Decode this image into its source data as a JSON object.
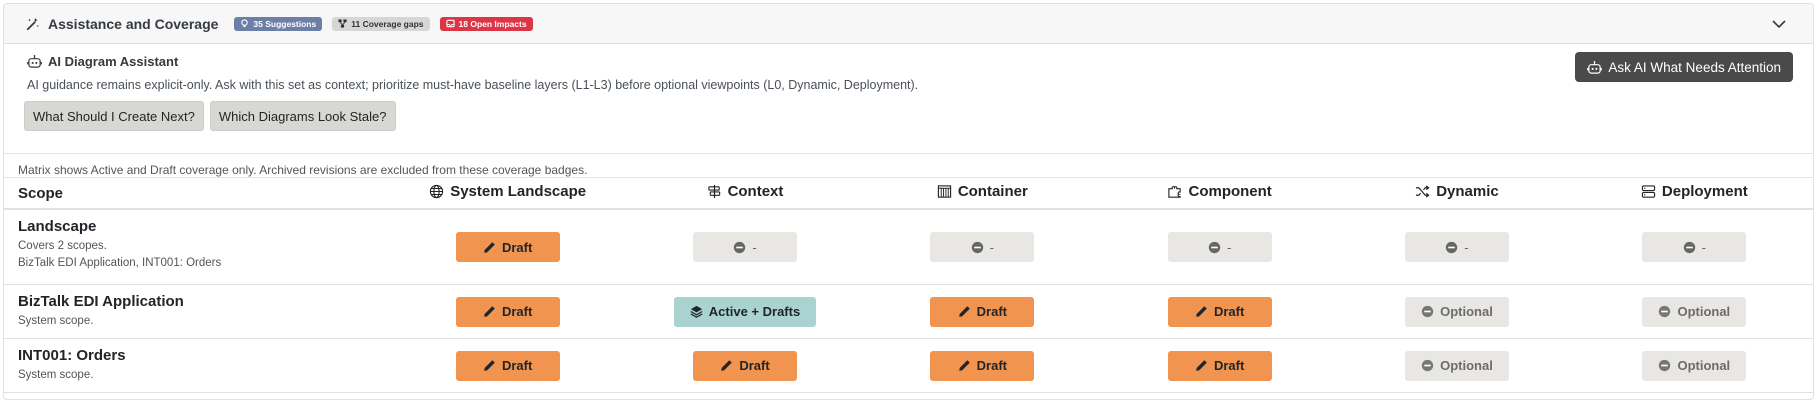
{
  "header": {
    "title": "Assistance and Coverage",
    "badges": {
      "suggestions": "35 Suggestions",
      "gaps": "11 Coverage gaps",
      "impacts": "18 Open Impacts"
    }
  },
  "assistant": {
    "title": "AI Diagram Assistant",
    "description": "AI guidance remains explicit-only. Ask with this set as context; prioritize must-have baseline layers (L1-L3) before optional viewpoints (L0, Dynamic, Deployment).",
    "buttons": {
      "next": "What Should I Create Next?",
      "stale": "Which Diagrams Look Stale?"
    },
    "ask_button": "Ask AI What Needs Attention"
  },
  "note": "Matrix shows Active and Draft coverage only. Archived revisions are excluded from these coverage badges.",
  "columns": {
    "scope": "Scope",
    "landscape": "System Landscape",
    "context": "Context",
    "container": "Container",
    "component": "Component",
    "dynamic": "Dynamic",
    "deployment": "Deployment"
  },
  "rows": [
    {
      "name": "Landscape",
      "meta": "Covers 2 scopes.",
      "meta2": "BizTalk EDI Application, INT001: Orders",
      "cells": [
        "Draft",
        "-",
        "-",
        "-",
        "-",
        "-"
      ]
    },
    {
      "name": "BizTalk EDI Application",
      "meta": "System scope.",
      "cells": [
        "Draft",
        "Active + Drafts",
        "Draft",
        "Draft",
        "Optional",
        "Optional"
      ]
    },
    {
      "name": "INT001: Orders",
      "meta": "System scope.",
      "cells": [
        "Draft",
        "Draft",
        "Draft",
        "Draft",
        "Optional",
        "Optional"
      ]
    }
  ],
  "colors": {
    "draft": "#f0944f",
    "active": "#a9d3d1",
    "neutral": "#e9e7e4",
    "impact": "#dc3545",
    "suggestions": "#6c7fa6",
    "dark_button": "#4a4a4a"
  }
}
